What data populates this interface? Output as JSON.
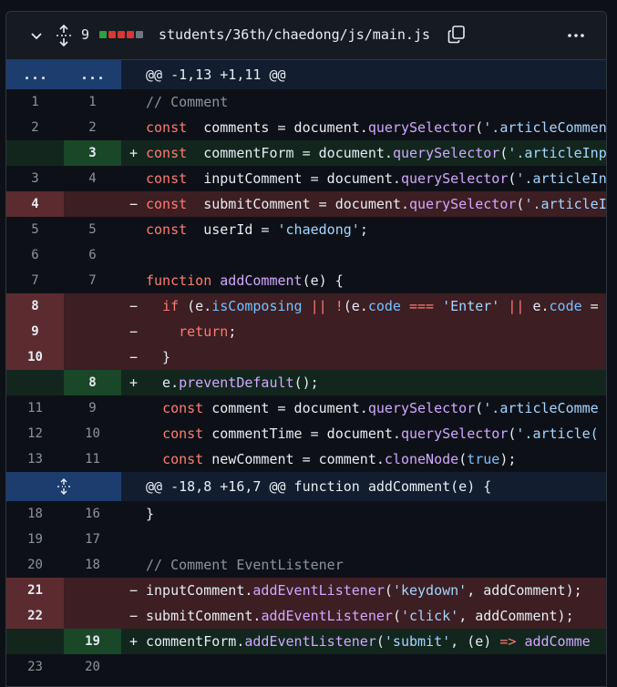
{
  "file": {
    "changes": "9",
    "path": "students/36th/chaedong/js/main.js",
    "diffstat": [
      "#2ea043",
      "#da3633",
      "#da3633",
      "#da3633",
      "#6e7681"
    ]
  },
  "hunks": [
    {
      "expand": "...",
      "header": "@@ -1,13 +1,11 @@"
    },
    {
      "header": "@@ -18,8 +16,7 @@ function addComment(e) {"
    }
  ],
  "lines": [
    {
      "type": "ctx",
      "old": "1",
      "new": "1",
      "sign": "",
      "tokens": [
        [
          "cm",
          "// Comment"
        ]
      ]
    },
    {
      "type": "ctx",
      "old": "2",
      "new": "2",
      "sign": "",
      "tokens": [
        [
          "kw",
          "const"
        ],
        [
          "",
          "  comments = document."
        ],
        [
          "fn",
          "querySelector"
        ],
        [
          "",
          "("
        ],
        [
          "str",
          "'.articleCommen"
        ]
      ]
    },
    {
      "type": "add",
      "old": "",
      "new": "3",
      "sign": "+",
      "tokens": [
        [
          "kw",
          "const"
        ],
        [
          "",
          "  commentForm = document."
        ],
        [
          "fn",
          "querySelector"
        ],
        [
          "",
          "("
        ],
        [
          "str",
          "'.articleInp"
        ]
      ]
    },
    {
      "type": "ctx",
      "old": "3",
      "new": "4",
      "sign": "",
      "tokens": [
        [
          "kw",
          "const"
        ],
        [
          "",
          "  inputComment = document."
        ],
        [
          "fn",
          "querySelector"
        ],
        [
          "",
          "("
        ],
        [
          "str",
          "'.articleIn"
        ]
      ]
    },
    {
      "type": "del",
      "old": "4",
      "new": "",
      "sign": "−",
      "tokens": [
        [
          "kw",
          "const"
        ],
        [
          "",
          "  submitComment = document."
        ],
        [
          "fn",
          "querySelector"
        ],
        [
          "",
          "("
        ],
        [
          "str",
          "'.articleI"
        ]
      ]
    },
    {
      "type": "ctx",
      "old": "5",
      "new": "5",
      "sign": "",
      "tokens": [
        [
          "kw",
          "const"
        ],
        [
          "",
          "  userId = "
        ],
        [
          "str",
          "'chaedong'"
        ],
        [
          "",
          ";"
        ]
      ]
    },
    {
      "type": "ctx",
      "old": "6",
      "new": "6",
      "sign": "",
      "tokens": []
    },
    {
      "type": "ctx",
      "old": "7",
      "new": "7",
      "sign": "",
      "tokens": [
        [
          "kw",
          "function"
        ],
        [
          "",
          " "
        ],
        [
          "fn",
          "addComment"
        ],
        [
          "",
          "(e) {"
        ]
      ]
    },
    {
      "type": "del",
      "old": "8",
      "new": "",
      "sign": "−",
      "tokens": [
        [
          "",
          "  "
        ],
        [
          "kw",
          "if"
        ],
        [
          "",
          " (e."
        ],
        [
          "cn",
          "isComposing"
        ],
        [
          "",
          " "
        ],
        [
          "kw",
          "||"
        ],
        [
          "",
          " "
        ],
        [
          "kw",
          "!"
        ],
        [
          "",
          "(e."
        ],
        [
          "cn",
          "code"
        ],
        [
          "",
          " "
        ],
        [
          "kw",
          "==="
        ],
        [
          "",
          " "
        ],
        [
          "str",
          "'Enter'"
        ],
        [
          "",
          " "
        ],
        [
          "kw",
          "||"
        ],
        [
          "",
          " e."
        ],
        [
          "cn",
          "code"
        ],
        [
          "",
          " ="
        ]
      ]
    },
    {
      "type": "del",
      "old": "9",
      "new": "",
      "sign": "−",
      "tokens": [
        [
          "",
          "    "
        ],
        [
          "kw",
          "return"
        ],
        [
          "",
          ";"
        ]
      ]
    },
    {
      "type": "del",
      "old": "10",
      "new": "",
      "sign": "−",
      "tokens": [
        [
          "",
          "  }"
        ]
      ]
    },
    {
      "type": "add",
      "old": "",
      "new": "8",
      "sign": "+",
      "tokens": [
        [
          "",
          "  e."
        ],
        [
          "fn",
          "preventDefault"
        ],
        [
          "",
          "();"
        ]
      ]
    },
    {
      "type": "ctx",
      "old": "11",
      "new": "9",
      "sign": "",
      "tokens": [
        [
          "",
          "  "
        ],
        [
          "kw",
          "const"
        ],
        [
          "",
          " comment = document."
        ],
        [
          "fn",
          "querySelector"
        ],
        [
          "",
          "("
        ],
        [
          "str",
          "'.articleComme"
        ]
      ]
    },
    {
      "type": "ctx",
      "old": "12",
      "new": "10",
      "sign": "",
      "tokens": [
        [
          "",
          "  "
        ],
        [
          "kw",
          "const"
        ],
        [
          "",
          " commentTime = document."
        ],
        [
          "fn",
          "querySelector"
        ],
        [
          "",
          "("
        ],
        [
          "str",
          "'.article("
        ]
      ]
    },
    {
      "type": "ctx",
      "old": "13",
      "new": "11",
      "sign": "",
      "tokens": [
        [
          "",
          "  "
        ],
        [
          "kw",
          "const"
        ],
        [
          "",
          " newComment = comment."
        ],
        [
          "fn",
          "cloneNode"
        ],
        [
          "",
          "("
        ],
        [
          "cn",
          "true"
        ],
        [
          "",
          ");"
        ]
      ]
    },
    {
      "type": "hunk2"
    },
    {
      "type": "ctx",
      "old": "18",
      "new": "16",
      "sign": "",
      "tokens": [
        [
          "",
          "}"
        ]
      ]
    },
    {
      "type": "ctx",
      "old": "19",
      "new": "17",
      "sign": "",
      "tokens": []
    },
    {
      "type": "ctx",
      "old": "20",
      "new": "18",
      "sign": "",
      "tokens": [
        [
          "cm",
          "// Comment EventListener"
        ]
      ]
    },
    {
      "type": "del",
      "old": "21",
      "new": "",
      "sign": "−",
      "tokens": [
        [
          "",
          "inputComment."
        ],
        [
          "fn",
          "addEventListener"
        ],
        [
          "",
          "("
        ],
        [
          "str",
          "'keydown'"
        ],
        [
          "",
          ", addComment);"
        ]
      ]
    },
    {
      "type": "del",
      "old": "22",
      "new": "",
      "sign": "−",
      "tokens": [
        [
          "",
          "submitComment."
        ],
        [
          "fn",
          "addEventListener"
        ],
        [
          "",
          "("
        ],
        [
          "str",
          "'click'"
        ],
        [
          "",
          ", addComment);"
        ]
      ]
    },
    {
      "type": "add",
      "old": "",
      "new": "19",
      "sign": "+",
      "tokens": [
        [
          "",
          "commentForm."
        ],
        [
          "fn",
          "addEventListener"
        ],
        [
          "",
          "("
        ],
        [
          "str",
          "'submit'"
        ],
        [
          "",
          ", (e) "
        ],
        [
          "kw",
          "=>"
        ],
        [
          "",
          " "
        ],
        [
          "fn",
          "addComme"
        ]
      ]
    },
    {
      "type": "ctx",
      "old": "23",
      "new": "20",
      "sign": "",
      "tokens": []
    }
  ]
}
